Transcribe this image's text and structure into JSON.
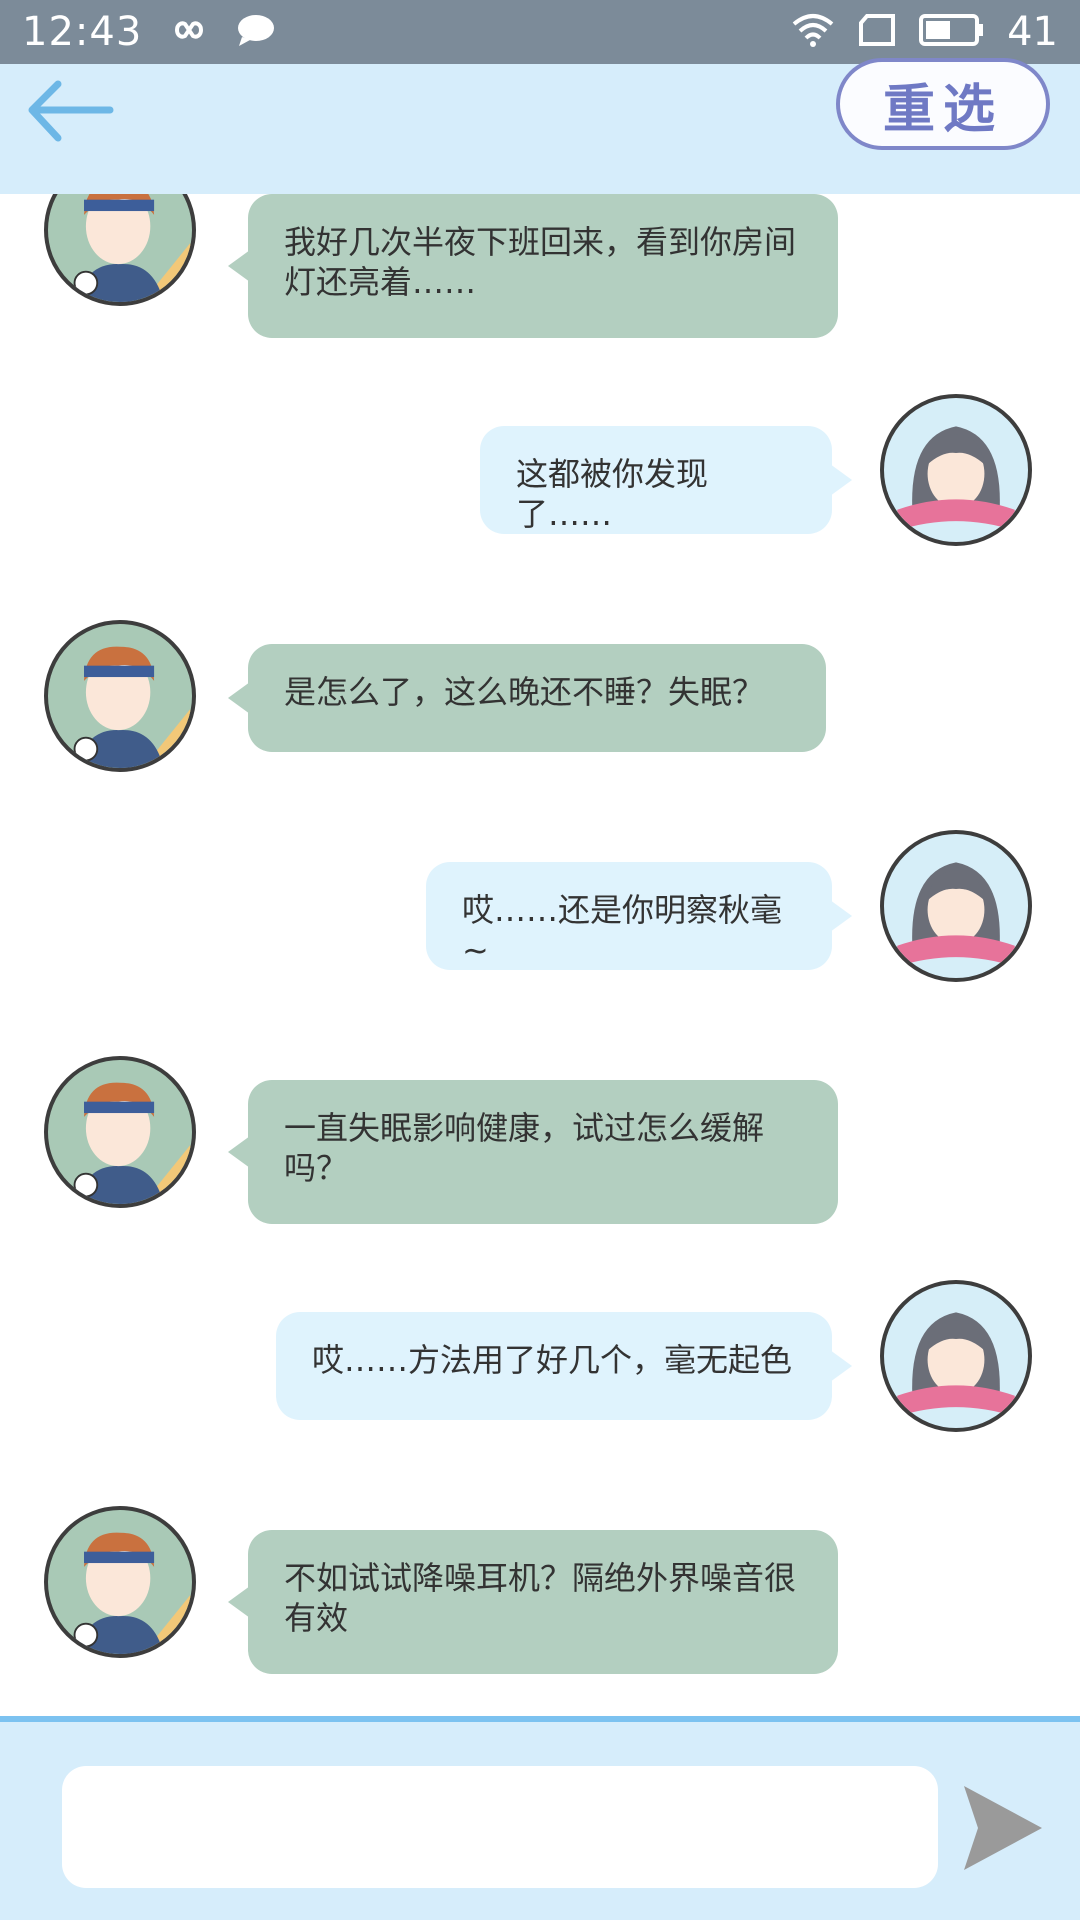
{
  "status_bar": {
    "time": "12:43",
    "battery_level": "41",
    "icons": [
      "infinity-icon",
      "chat-bubble-icon",
      "wifi-icon",
      "sim-card-icon",
      "battery-icon"
    ]
  },
  "header": {
    "back_icon": "arrow-left-icon",
    "reselect_label": "重选"
  },
  "messages": [
    {
      "speaker": "boy",
      "text": "我好几次半夜下班回来，看到你房间灯还亮着……"
    },
    {
      "speaker": "girl",
      "text": "这都被你发现了……"
    },
    {
      "speaker": "boy",
      "text": "是怎么了，这么晚还不睡？失眠？"
    },
    {
      "speaker": "girl",
      "text": "哎……还是你明察秋毫~"
    },
    {
      "speaker": "boy",
      "text": "一直失眠影响健康，试过怎么缓解吗？"
    },
    {
      "speaker": "girl",
      "text": "哎……方法用了好几个，毫无起色"
    },
    {
      "speaker": "boy",
      "text": "不如试试降噪耳机？隔绝外界噪音很有效"
    }
  ],
  "input": {
    "placeholder": "",
    "value": "",
    "send_icon": "send-arrow-icon"
  },
  "colors": {
    "status_bar": "#7c8b99",
    "header_bg": "#d6edfb",
    "boy_bubble": "#b3cfc0",
    "girl_bubble": "#dff3fd",
    "accent_line": "#7cc2f0",
    "reselect_border": "#7f87c9"
  }
}
